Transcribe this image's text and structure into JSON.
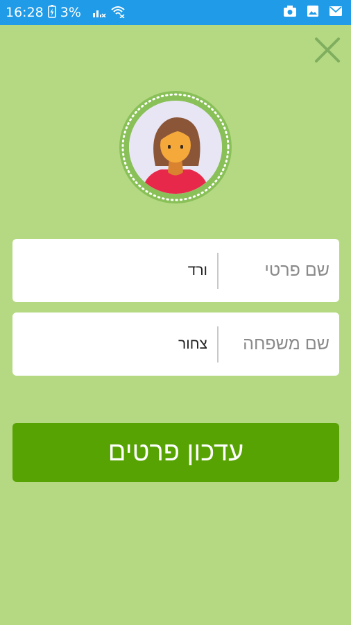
{
  "status_bar": {
    "time": "16:28",
    "battery": "3%",
    "icons": [
      "charging-battery-icon",
      "signal-icon",
      "wifi-icon",
      "camera-notification-icon",
      "image-notification-icon",
      "mail-notification-icon"
    ]
  },
  "colors": {
    "background": "#b5d983",
    "status_bar": "#1f9be8",
    "button": "#57a303",
    "avatar_ring": "#89c058"
  },
  "form": {
    "first_name": {
      "label": "שם פרטי",
      "value": "ורד"
    },
    "last_name": {
      "label": "שם משפחה",
      "value": "צחור"
    },
    "submit_label": "עדכון פרטים"
  }
}
